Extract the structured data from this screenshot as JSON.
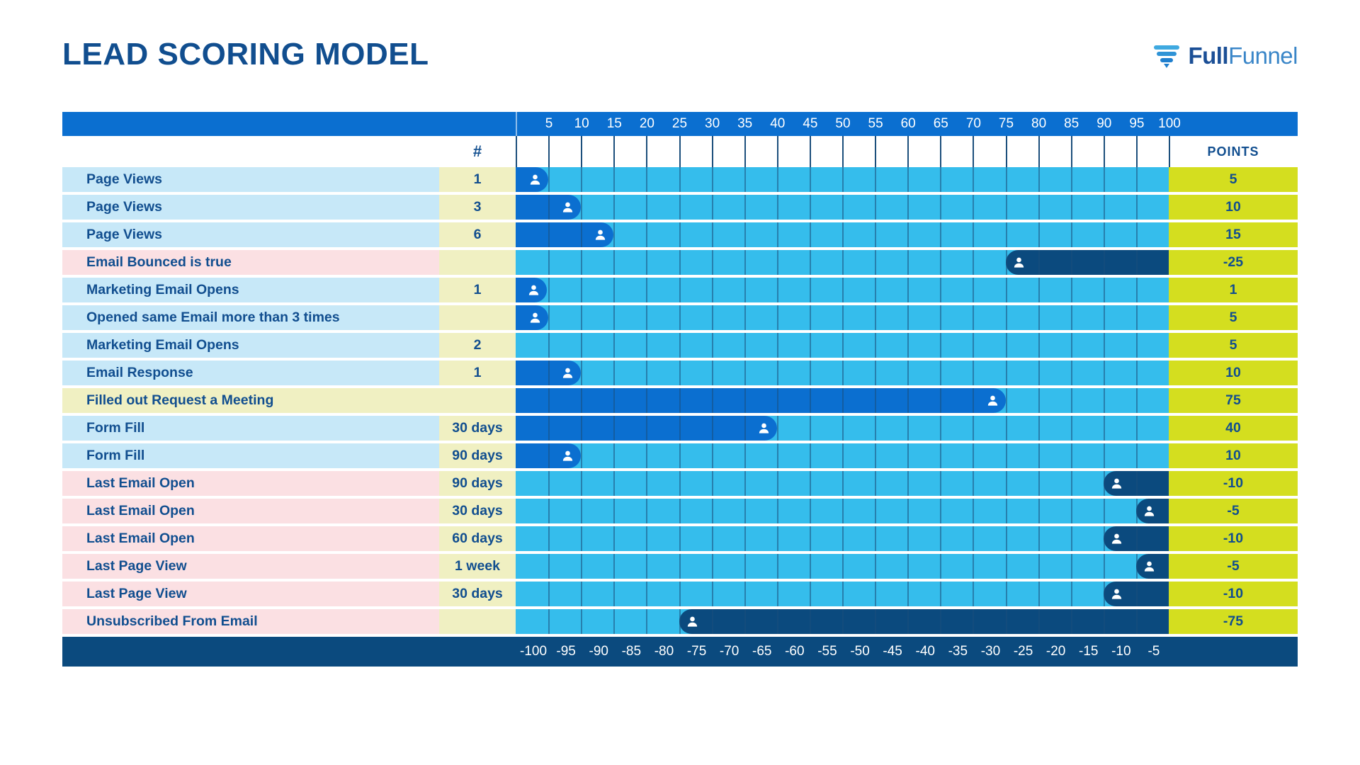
{
  "header": {
    "title": "LEAD SCORING MODEL",
    "logo": {
      "bold": "Full",
      "light": "Funnel",
      "icon": "funnel-icon"
    }
  },
  "columns": {
    "hash_label": "#",
    "points_label": "POINTS"
  },
  "chart_data": {
    "type": "bar",
    "title": "LEAD SCORING MODEL",
    "xlabel": "",
    "ylabel": "",
    "grid": true,
    "positive_axis": {
      "ticks": [
        5,
        10,
        15,
        20,
        25,
        30,
        35,
        40,
        45,
        50,
        55,
        60,
        65,
        70,
        75,
        80,
        85,
        90,
        95,
        100
      ],
      "min": 0,
      "max": 100
    },
    "negative_axis": {
      "ticks": [
        -100,
        -95,
        -90,
        -85,
        -80,
        -75,
        -70,
        -65,
        -60,
        -55,
        -50,
        -45,
        -40,
        -35,
        -30,
        -25,
        -20,
        -15,
        -10,
        -5
      ],
      "min": -100,
      "max": 0
    },
    "categories": [
      "Page Views",
      "Page Views",
      "Page Views",
      "Email Bounced is true",
      "Marketing Email Opens",
      "Opened same Email more than 3 times",
      "Marketing Email Opens",
      "Email Response",
      "Filled out Request a Meeting",
      "Form Fill",
      "Form Fill",
      "Last Email Open",
      "Last Email Open",
      "Last Email Open",
      "Last Page View",
      "Last Page View",
      "Unsubscribed From Email"
    ],
    "values": [
      5,
      10,
      15,
      -25,
      1,
      5,
      5,
      10,
      75,
      40,
      10,
      -10,
      -5,
      -10,
      -5,
      -10,
      -75
    ]
  },
  "rows": [
    {
      "label": "Page Views",
      "num": "1",
      "points": "5",
      "value": 5,
      "tone": "blue"
    },
    {
      "label": "Page Views",
      "num": "3",
      "points": "10",
      "value": 10,
      "tone": "blue"
    },
    {
      "label": "Page Views",
      "num": "6",
      "points": "15",
      "value": 15,
      "tone": "blue"
    },
    {
      "label": "Email Bounced is true",
      "num": "",
      "points": "-25",
      "value": -25,
      "tone": "pink"
    },
    {
      "label": "Marketing Email Opens",
      "num": "1",
      "points": "1",
      "value": 1,
      "tone": "blue"
    },
    {
      "label": "Opened same Email more than 3 times",
      "num": "",
      "points": "5",
      "value": 5,
      "tone": "blue"
    },
    {
      "label": "Marketing Email Opens",
      "num": "2",
      "points": "5",
      "value": 0,
      "tone": "blue"
    },
    {
      "label": "Email Response",
      "num": "1",
      "points": "10",
      "value": 10,
      "tone": "blue"
    },
    {
      "label": "Filled out Request a Meeting",
      "num": "",
      "points": "75",
      "value": 75,
      "tone": "yellow"
    },
    {
      "label": "Form Fill",
      "num": "30 days",
      "points": "40",
      "value": 40,
      "tone": "blue"
    },
    {
      "label": "Form Fill",
      "num": "90 days",
      "points": "10",
      "value": 10,
      "tone": "blue"
    },
    {
      "label": "Last Email Open",
      "num": "90 days",
      "points": "-10",
      "value": -10,
      "tone": "pink"
    },
    {
      "label": "Last Email Open",
      "num": "30 days",
      "points": "-5",
      "value": -5,
      "tone": "pink"
    },
    {
      "label": "Last Email Open",
      "num": "60 days",
      "points": "-10",
      "value": -10,
      "tone": "pink"
    },
    {
      "label": "Last Page View",
      "num": "1 week",
      "points": "-5",
      "value": -5,
      "tone": "pink"
    },
    {
      "label": "Last Page View",
      "num": "30 days",
      "points": "-10",
      "value": -10,
      "tone": "pink"
    },
    {
      "label": "Unsubscribed From Email",
      "num": "",
      "points": "-75",
      "value": -75,
      "tone": "pink"
    }
  ],
  "colors": {
    "navy": "#114e8f",
    "header_blue": "#0b6fd0",
    "track_blue": "#35bdec",
    "bar_blue": "#0b6fd0",
    "bar_navy": "#0b4a7e",
    "points_yellow": "#d4de1f",
    "label_blue": "#c7e8f8",
    "label_pink": "#fbe0e3",
    "label_yellow": "#f0f0c2"
  }
}
